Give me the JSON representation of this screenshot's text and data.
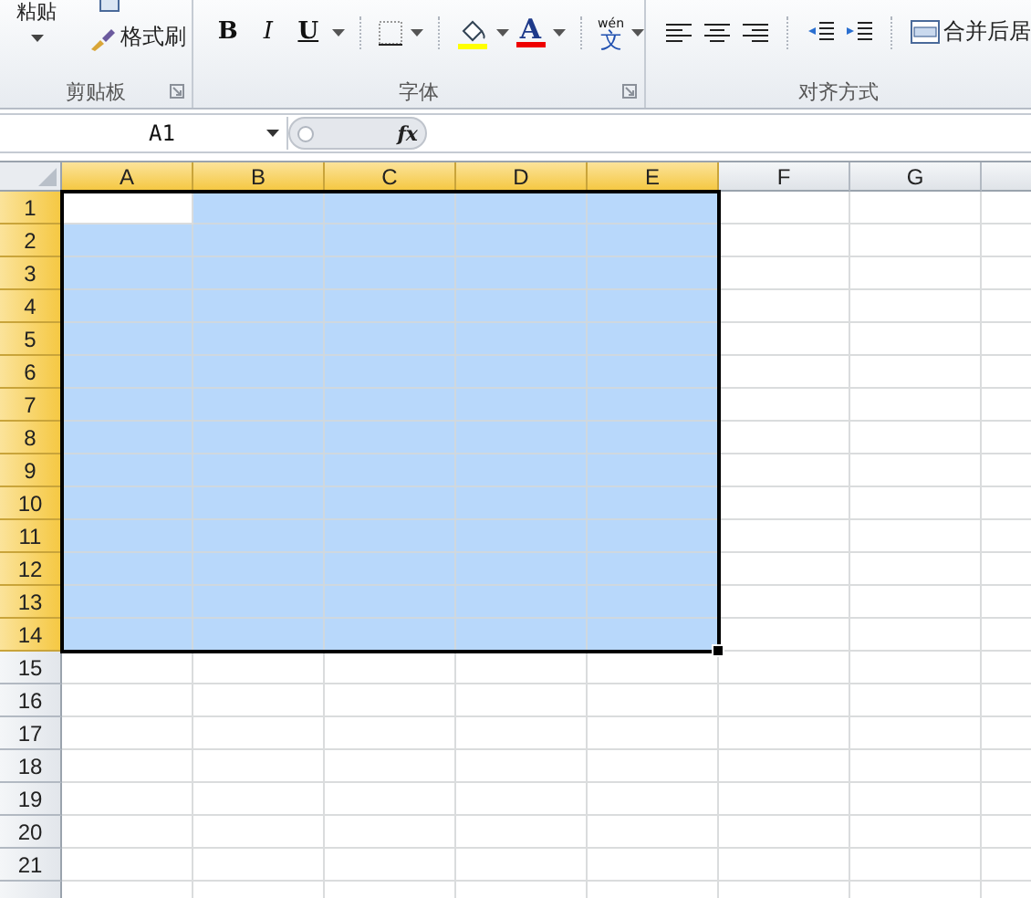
{
  "ribbon": {
    "groups": [
      {
        "kind": "clipboard",
        "label": "剪贴板",
        "paste": "粘贴",
        "format_painter": "格式刷"
      },
      {
        "kind": "font",
        "label": "字体",
        "bold": "B",
        "italic": "I",
        "underline": "U",
        "font_color": "A",
        "phonetic_top": "wén",
        "phonetic_char": "文"
      },
      {
        "kind": "alignment",
        "label": "对齐方式",
        "merge": "合并后居"
      }
    ]
  },
  "formula_bar": {
    "name_box": "A1",
    "fx": "fx"
  },
  "sheet": {
    "columns": [
      {
        "label": "A",
        "selected": true,
        "active": true
      },
      {
        "label": "B",
        "selected": true,
        "active": false
      },
      {
        "label": "C",
        "selected": true,
        "active": false
      },
      {
        "label": "D",
        "selected": true,
        "active": false
      },
      {
        "label": "E",
        "selected": true,
        "active": false
      },
      {
        "label": "F",
        "selected": false,
        "active": false
      },
      {
        "label": "G",
        "selected": false,
        "active": false
      }
    ],
    "rows": [
      {
        "label": "1",
        "selected": true,
        "active": true
      },
      {
        "label": "2",
        "selected": true,
        "active": false
      },
      {
        "label": "3",
        "selected": true,
        "active": false
      },
      {
        "label": "4",
        "selected": true,
        "active": false
      },
      {
        "label": "5",
        "selected": true,
        "active": false
      },
      {
        "label": "6",
        "selected": true,
        "active": false
      },
      {
        "label": "7",
        "selected": true,
        "active": false
      },
      {
        "label": "8",
        "selected": true,
        "active": false
      },
      {
        "label": "9",
        "selected": true,
        "active": false
      },
      {
        "label": "10",
        "selected": true,
        "active": false
      },
      {
        "label": "11",
        "selected": true,
        "active": false
      },
      {
        "label": "12",
        "selected": true,
        "active": false
      },
      {
        "label": "13",
        "selected": true,
        "active": false
      },
      {
        "label": "14",
        "selected": true,
        "active": false
      },
      {
        "label": "15",
        "selected": false,
        "active": false
      },
      {
        "label": "16",
        "selected": false,
        "active": false
      },
      {
        "label": "17",
        "selected": false,
        "active": false
      },
      {
        "label": "18",
        "selected": false,
        "active": false
      },
      {
        "label": "19",
        "selected": false,
        "active": false
      },
      {
        "label": "20",
        "selected": false,
        "active": false
      },
      {
        "label": "21",
        "selected": false,
        "active": false
      }
    ]
  }
}
